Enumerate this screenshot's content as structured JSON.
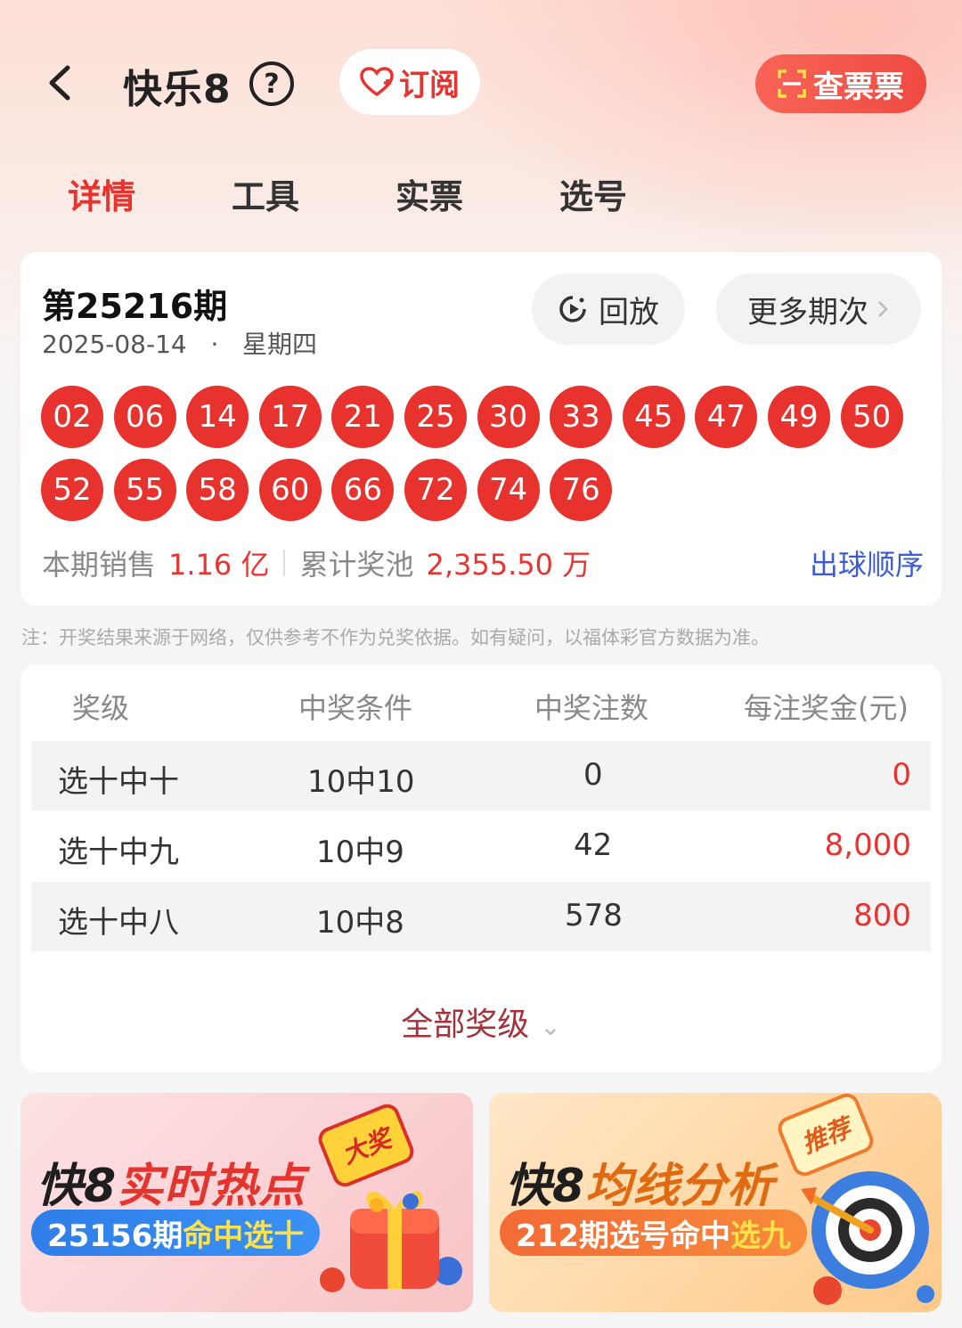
{
  "header": {
    "title": "快乐8",
    "help_symbol": "?",
    "subscribe_label": "订阅",
    "check_label": "查票票"
  },
  "tabs": [
    "详情",
    "工具",
    "实票",
    "选号"
  ],
  "active_tab": 0,
  "draw": {
    "issue": "第25216期",
    "date": "2025-08-14",
    "separator": "·",
    "weekday": "星期四",
    "replay_label": "回放",
    "more_label": "更多期次",
    "numbers": [
      "02",
      "06",
      "14",
      "17",
      "21",
      "25",
      "30",
      "33",
      "45",
      "47",
      "49",
      "50",
      "52",
      "55",
      "58",
      "60",
      "66",
      "72",
      "74",
      "76"
    ],
    "sales_label": "本期销售",
    "sales_value": "1.16 亿",
    "pool_label": "累计奖池",
    "pool_value": "2,355.50 万",
    "ball_order_label": "出球顺序"
  },
  "note": "注：开奖结果来源于网络，仅供参考不作为兑奖依据。如有疑问，以福体彩官方数据为准。",
  "prize_table": {
    "headers": [
      "奖级",
      "中奖条件",
      "中奖注数",
      "每注奖金(元)"
    ],
    "rows": [
      {
        "level": "选十中十",
        "condition": "10中10",
        "count": "0",
        "prize": "0"
      },
      {
        "level": "选十中九",
        "condition": "10中9",
        "count": "42",
        "prize": "8,000"
      },
      {
        "level": "选十中八",
        "condition": "10中8",
        "count": "578",
        "prize": "800"
      }
    ],
    "all_levels_label": "全部奖级"
  },
  "banners": [
    {
      "title_a": "快8",
      "title_b": "实时热点",
      "pill_a": "25156期",
      "pill_b": "命中选十",
      "badge": "大奖"
    },
    {
      "title_a": "快8",
      "title_b": "均线分析",
      "pill_a": "212期选号命中",
      "pill_b": "选九",
      "badge": "推荐"
    }
  ],
  "colors": {
    "accent_red": "#e8332e",
    "ball_red": "#e8322e",
    "link_blue": "#3b5bd6"
  }
}
